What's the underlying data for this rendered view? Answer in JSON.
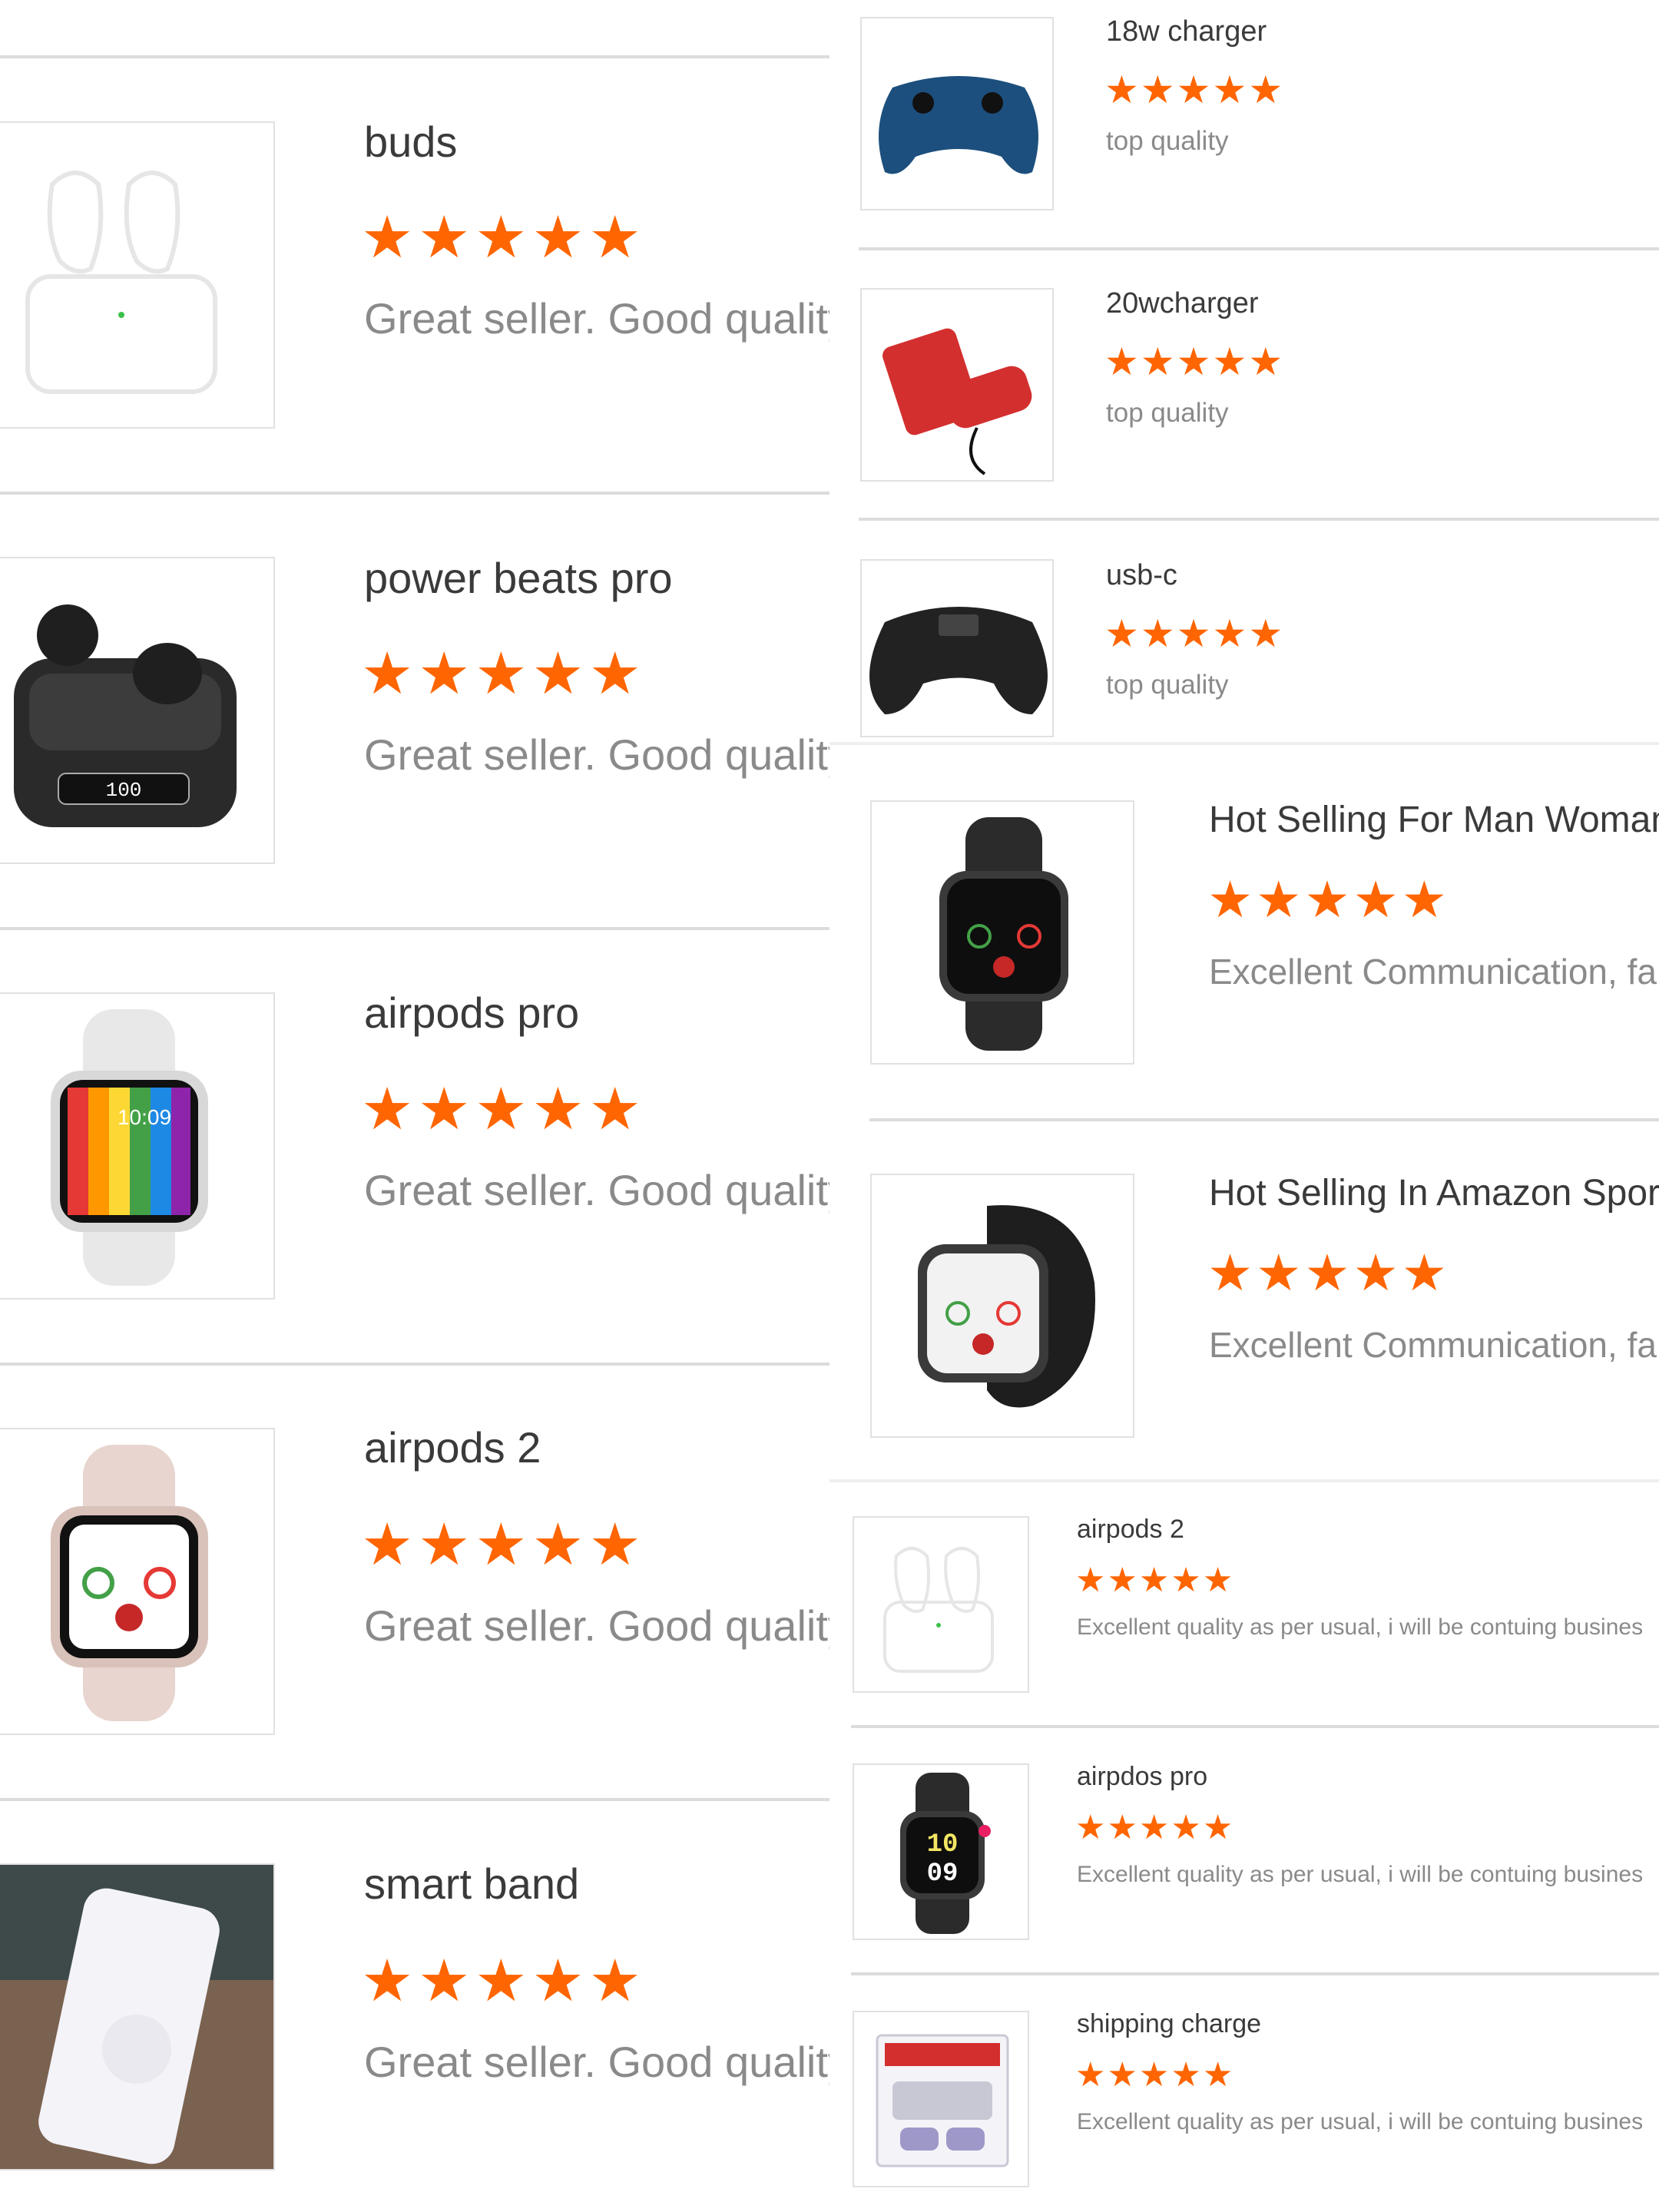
{
  "left_list": [
    {
      "title": "buds",
      "review": "Great seller. Good quality",
      "stars": 5,
      "icon": "earbuds-case-outline-image"
    },
    {
      "title": "power beats pro",
      "review": "Great seller. Good quality",
      "stars": 5,
      "icon": "black-earbuds-case-image"
    },
    {
      "title": "airpods pro",
      "review": "Great seller. Good quality",
      "stars": 5,
      "icon": "rainbow-smartwatch-image",
      "screen_text": "10:09"
    },
    {
      "title": "airpods 2",
      "review": "Great seller. Good quality",
      "stars": 5,
      "icon": "pink-smartwatch-image"
    },
    {
      "title": "smart band",
      "review": "Great seller. Good quality",
      "stars": 5,
      "icon": "glitter-phone-case-image"
    }
  ],
  "right_top_list": [
    {
      "title": "18w charger",
      "review": "top quality",
      "stars": 5,
      "icon": "blue-gamepad-image"
    },
    {
      "title": "20wcharger",
      "review": "top quality",
      "stars": 5,
      "icon": "red-handheld-console-image"
    },
    {
      "title": "usb-c",
      "review": "top quality",
      "stars": 5,
      "icon": "black-controller-image"
    }
  ],
  "right_mid_list": [
    {
      "title": "Hot Selling For Man Woman",
      "review": "Excellent Communication, fa",
      "stars": 5,
      "icon": "black-smartwatch-image"
    },
    {
      "title": "Hot Selling In Amazon Sport",
      "review": "Excellent Communication, fa",
      "stars": 5,
      "icon": "black-sport-smartwatch-image"
    }
  ],
  "right_bottom_list": [
    {
      "title": "airpods 2",
      "review": "Excellent quality as per usual, i will be contuing busines",
      "stars": 5,
      "icon": "earbuds-case-outline-image"
    },
    {
      "title": "airpdos pro",
      "review": "Excellent quality as per usual, i will be contuing busines",
      "stars": 5,
      "icon": "digital-smartwatch-image",
      "screen_text": "10 09"
    },
    {
      "title": "shipping charge",
      "review": "Excellent quality as per usual, i will be contuing busines",
      "stars": 5,
      "icon": "retro-console-box-image"
    }
  ],
  "colors": {
    "star": "#ff6500",
    "title": "#3a3a3a",
    "review": "#8a8a8a",
    "divider": "#dcdcdc"
  }
}
